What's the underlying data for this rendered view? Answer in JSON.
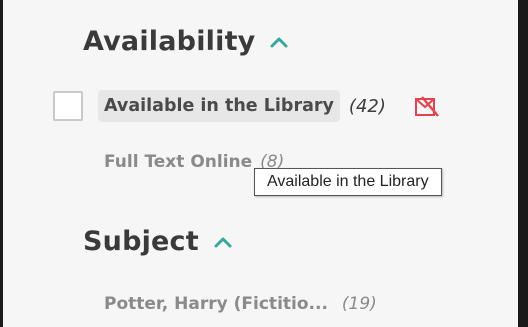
{
  "availability": {
    "header": "Availability",
    "items": [
      {
        "label": "Available in the Library",
        "count": "(42)"
      },
      {
        "label": "Full Text Online",
        "count": "(8)"
      }
    ]
  },
  "subject": {
    "header": "Subject",
    "items": [
      {
        "label": "Potter, Harry (Fictitio...",
        "count": "(19)"
      }
    ]
  },
  "tooltip": {
    "text": "Available in the Library"
  },
  "colors": {
    "accent": "#3aa7a0",
    "exclude": "#e0454f"
  }
}
